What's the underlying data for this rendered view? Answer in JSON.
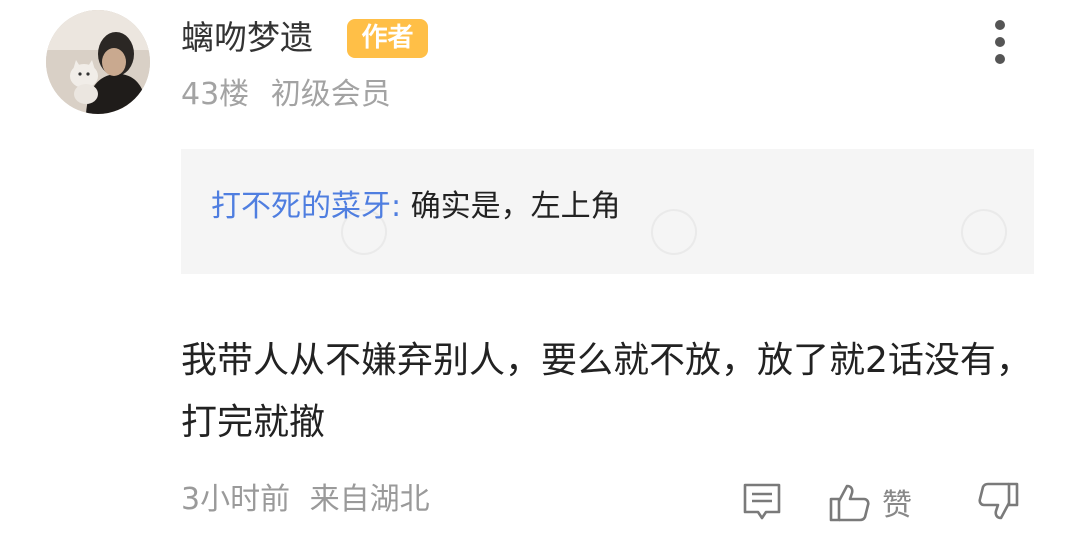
{
  "comment": {
    "author": "螭吻梦遗",
    "author_badge": "作者",
    "floor": "43楼",
    "member_level": "初级会员",
    "quote": {
      "author": "打不死的菜牙:",
      "text": " 确实是，左上角"
    },
    "content": "我带人从不嫌弃别人，要么就不放，放了就2话没有，打完就撤",
    "time": "3小时前",
    "location": "来自湖北",
    "like_label": "赞"
  },
  "colors": {
    "badge": "#ffbf47",
    "quote_author": "#4f7ee0",
    "quote_background": "#f5f5f5",
    "meta_text": "#a3a3a3"
  },
  "icons": {
    "more": "more-vertical-icon",
    "reply": "comment-icon",
    "like": "thumbs-up-icon",
    "dislike": "thumbs-down-icon"
  }
}
